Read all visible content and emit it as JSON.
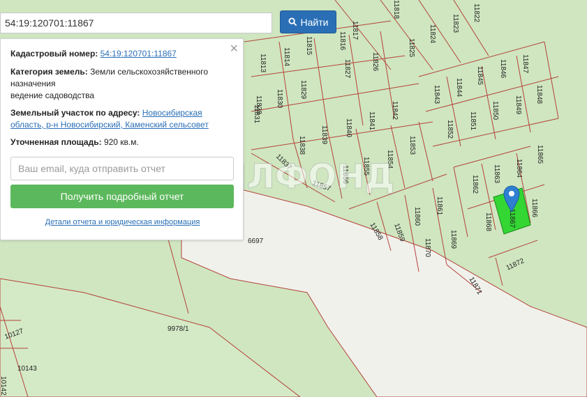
{
  "search": {
    "value": "54:19:120701:11867",
    "button_label": "Найти"
  },
  "panel": {
    "cadastral_label": "Кадастровый номер:",
    "cadastral_value": "54:19:120701:11867",
    "category_label": "Категория земель:",
    "category_value": "Земли сельскохозяйственного назначения",
    "category_use": "ведение садоводства",
    "address_label": "Земельный участок по адресу:",
    "address_value": "Новосибирская область, р-н Новосибирский, Каменский сельсовет",
    "area_label": "Уточненная площадь:",
    "area_value": "920 кв.м.",
    "email_placeholder": "Ваш email, куда отправить отчет",
    "report_button": "Получить подробный отчет",
    "details_link": "Детали отчета и юридическая информация"
  },
  "map": {
    "watermark": "ЖИЛФОНД",
    "parcel_labels": [
      "11817",
      "11816",
      "11818",
      "11822",
      "11823",
      "11824",
      "11825",
      "11826",
      "11827",
      "11828",
      "11829",
      "11830",
      "11831",
      "11813",
      "11814",
      "11815",
      "11847",
      "11846",
      "11845",
      "11844",
      "11843",
      "11848",
      "11849",
      "11850",
      "11851",
      "11852",
      "11842",
      "11841",
      "11840",
      "11839",
      "11838",
      "11837",
      "11853",
      "11854",
      "11855",
      "11856",
      "11857",
      "11858",
      "11859",
      "11860",
      "11861",
      "11862",
      "11863",
      "11864",
      "11865",
      "11866",
      "11867",
      "11868",
      "11869",
      "11870",
      "11871",
      "11872",
      "6697",
      "9978/1",
      "10127",
      "10143",
      "10142"
    ],
    "selected_parcel": "11867"
  },
  "colors": {
    "land": "#cfe6c0",
    "road": "#f1f1ec",
    "border": "#b5423a",
    "selected": "#33d633",
    "marker": "#2f80d1",
    "button_blue": "#2a6fb6",
    "button_green": "#5cb85c"
  },
  "icons": [
    "search-icon",
    "close-icon",
    "map-marker-icon"
  ]
}
